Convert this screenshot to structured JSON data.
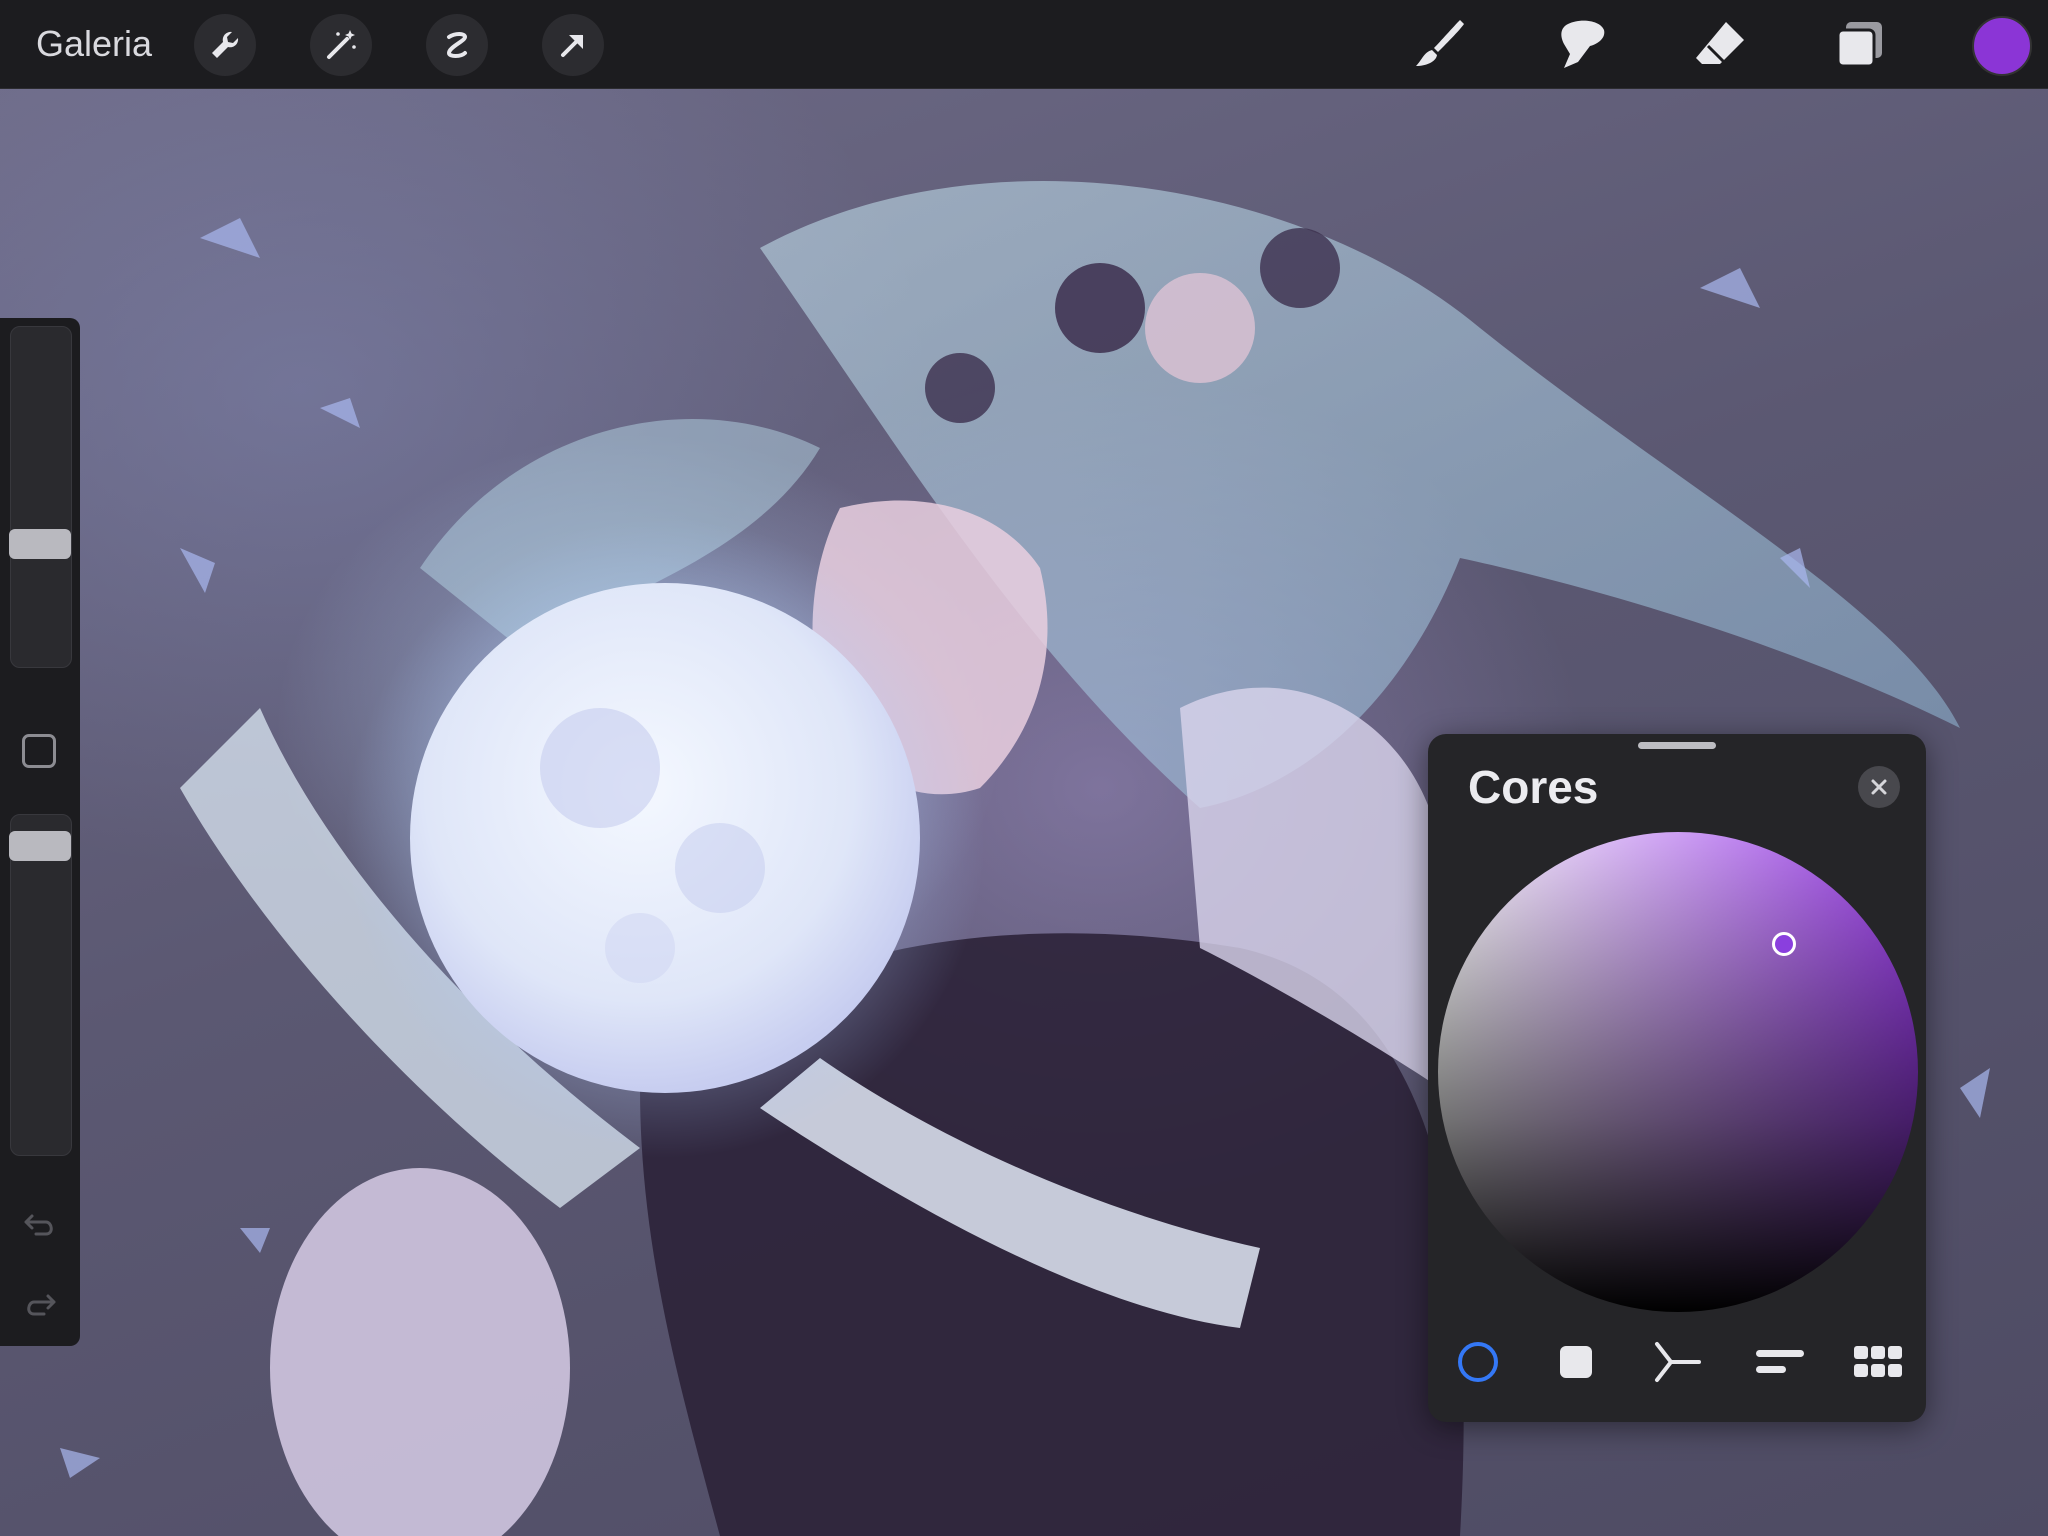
{
  "toolbar": {
    "gallery_label": "Galeria",
    "left_tools": [
      "wrench-icon",
      "magic-wand-icon",
      "selection-icon",
      "transform-arrow-icon"
    ],
    "right_tools": [
      "brush-icon",
      "smudge-icon",
      "eraser-icon",
      "layers-icon"
    ],
    "current_color": "#8b35d6"
  },
  "sidebar": {
    "brush_size_level": 0.35,
    "opacity_level": 0.95,
    "undo_icon": "undo-icon",
    "redo_icon": "redo-icon"
  },
  "color_panel": {
    "title": "Cores",
    "selected_color": "#8a3fde",
    "modes": [
      "disc",
      "classic",
      "harmony",
      "value",
      "palettes"
    ],
    "active_mode": "disc",
    "accent": "#3478f6"
  }
}
